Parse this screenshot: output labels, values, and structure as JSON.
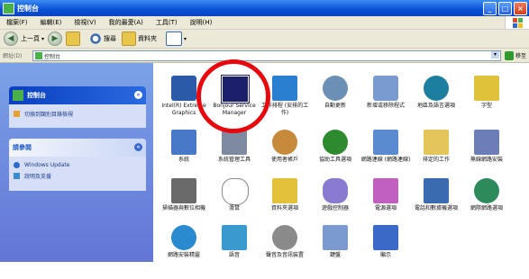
{
  "window": {
    "title": "控制台",
    "controls": [
      "_",
      "□",
      "×"
    ]
  },
  "menu": [
    "檔案(F)",
    "編輯(E)",
    "檢視(V)",
    "我的最愛(A)",
    "工具(T)",
    "說明(H)"
  ],
  "toolbar": {
    "back": "上一頁",
    "search": "搜尋",
    "folders": "資料夾",
    "views": "檢視"
  },
  "address": {
    "label": "網址(D)",
    "value": "控制台",
    "go": "移至"
  },
  "sidebar": {
    "control_panel": {
      "title": "控制台",
      "link": "切換到類別目錄檢視"
    },
    "see_also": {
      "title": "請參閱",
      "links": [
        "Windows Update",
        "說明及支援"
      ]
    }
  },
  "items": [
    {
      "label": "Intel(R) Extreme Graphics",
      "icon": "intel-graphics-icon",
      "color": "#2b5aa8"
    },
    {
      "label": "Bonjour Service Manager",
      "icon": "bonjour-icon",
      "color": "#1c1f6b"
    },
    {
      "label": "工作排程 (安排的工作)",
      "icon": "scheduled-tasks-icon",
      "color": "#2a7fd1"
    },
    {
      "label": "自動更新",
      "icon": "automatic-updates-icon",
      "color": "#6b8fb5"
    },
    {
      "label": "新增或移除程式",
      "icon": "add-remove-programs-icon",
      "color": "#7a9bd0"
    },
    {
      "label": "地區及語言選項",
      "icon": "regional-language-icon",
      "color": "#1d7fa0"
    },
    {
      "label": "字型",
      "icon": "fonts-icon",
      "color": "#e0c23a"
    },
    {
      "label": "系統",
      "icon": "system-icon",
      "color": "#4878c8"
    },
    {
      "label": "系統管理工具",
      "icon": "administrative-tools-icon",
      "color": "#7d8aa0"
    },
    {
      "label": "使用者帳戶",
      "icon": "user-accounts-icon",
      "color": "#c78a3a"
    },
    {
      "label": "協助工具選項",
      "icon": "accessibility-icon",
      "color": "#2e8a2e"
    },
    {
      "label": "網路連線 (網路連線)",
      "icon": "network-connections-icon",
      "color": "#5a8ad0"
    },
    {
      "label": "排定的工作",
      "icon": "scheduled-work-icon",
      "color": "#e3c55a"
    },
    {
      "label": "無線網路安裝",
      "icon": "wireless-network-icon",
      "color": "#6d7db8"
    },
    {
      "label": "掃描器與數位相機",
      "icon": "scanners-cameras-icon",
      "color": "#6a6a6a"
    },
    {
      "label": "滑鼠",
      "icon": "mouse-icon",
      "color": "#d0d0d0"
    },
    {
      "label": "資料夾選項",
      "icon": "folder-options-icon",
      "color": "#e3c13a"
    },
    {
      "label": "遊戲控制器",
      "icon": "game-controllers-icon",
      "color": "#8a7ad0"
    },
    {
      "label": "電源選項",
      "icon": "power-options-icon",
      "color": "#c060c0"
    },
    {
      "label": "電話和數據機選項",
      "icon": "phone-modem-icon",
      "color": "#3a6ab0"
    },
    {
      "label": "網際網路選項",
      "icon": "internet-options-icon",
      "color": "#2d8a5a"
    },
    {
      "label": "網路安裝精靈",
      "icon": "network-setup-icon",
      "color": "#2a8ad0"
    },
    {
      "label": "語音",
      "icon": "speech-icon",
      "color": "#3a9ad0"
    },
    {
      "label": "聲音及音訊裝置",
      "icon": "sounds-audio-icon",
      "color": "#8a8a8a"
    },
    {
      "label": "鍵盤",
      "icon": "keyboard-icon",
      "color": "#7a9ad0"
    },
    {
      "label": "顯示",
      "icon": "display-icon",
      "color": "#3a6ac8"
    }
  ]
}
